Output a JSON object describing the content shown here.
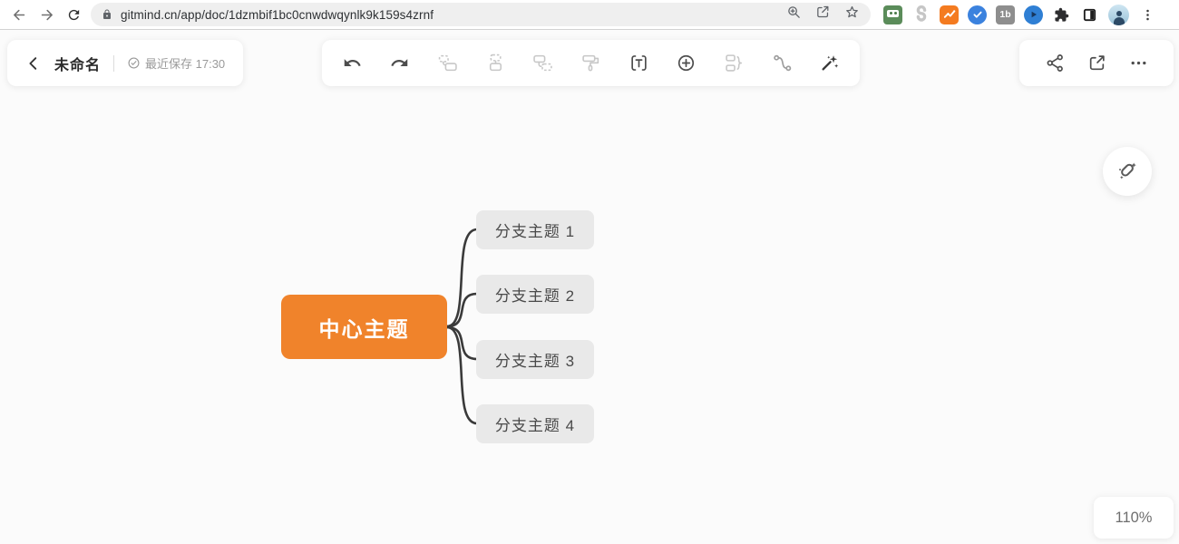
{
  "browser": {
    "url": "gitmind.cn/app/doc/1dzmbif1bc0cnwdwqynlk9k159s4zrnf",
    "extension_badge_1b": "1b",
    "icons": [
      "back-icon",
      "forward-icon",
      "reload-icon",
      "lock-icon",
      "zoom-in-icon",
      "share-page-icon",
      "bookmark-star-icon",
      "roboform-extension-icon",
      "s-logo-extension-icon",
      "analytics-extension-icon",
      "check-badge-extension-icon",
      "1b-extension-icon",
      "send-extension-icon",
      "extensions-puzzle-icon",
      "reader-panel-extension-icon",
      "profile-avatar",
      "browser-menu-icon"
    ]
  },
  "doc_toolbar": {
    "title": "未命名",
    "saved_status": "最近保存 17:30",
    "left_icons": [
      "chevron-left-icon",
      "check-circle-icon"
    ],
    "center_icons": [
      "undo-icon",
      "redo-icon",
      "insert-parent-node-icon",
      "insert-sibling-node-icon",
      "insert-child-node-icon",
      "format-painter-icon",
      "label-icon",
      "insert-plus-icon",
      "summary-icon",
      "relation-line-icon",
      "magic-wand-icon"
    ],
    "right_icons": [
      "share-nodes-icon",
      "export-icon",
      "more-icon"
    ],
    "floating_icon": "style-brush-icon"
  },
  "mindmap": {
    "center_topic": "中心主题",
    "branches": [
      "分支主题 1",
      "分支主题 2",
      "分支主题 3",
      "分支主题 4"
    ],
    "colors": {
      "center_bg": "#F0832B",
      "center_text": "#FFFFFF",
      "branch_bg": "#E9E9E9",
      "branch_text": "#4A4A4A",
      "connector": "#3A3A3A"
    }
  },
  "status_bar": {
    "zoom_level": "110%"
  }
}
